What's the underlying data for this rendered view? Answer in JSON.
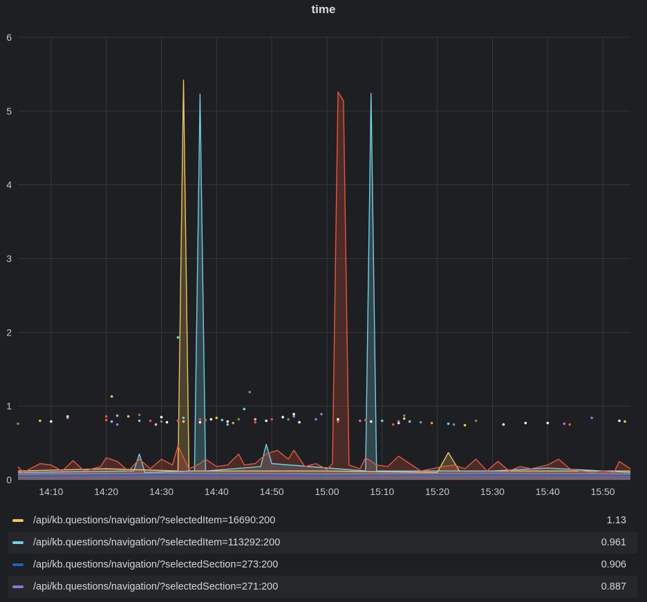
{
  "panel": {
    "title": "time"
  },
  "chart_data": {
    "type": "line",
    "x_ticks": [
      "14:10",
      "14:20",
      "14:30",
      "14:40",
      "14:50",
      "15:00",
      "15:10",
      "15:20",
      "15:30",
      "15:40",
      "15:50"
    ],
    "y_ticks": [
      "0",
      "1",
      "2",
      "3",
      "4",
      "5",
      "6"
    ],
    "ylim": [
      0,
      6
    ],
    "xlim": [
      "14:04",
      "15:55"
    ],
    "grid": true,
    "legend_placement": "bottom",
    "series": [
      {
        "name": "/api/kb.questions/navigation/?selectedItem=16690:200",
        "color": "#f2c55c",
        "legend_value": "1.13",
        "points": [
          [
            "14:04",
            0.12
          ],
          [
            "14:20",
            0.15
          ],
          [
            "14:33",
            0.12
          ],
          [
            "14:34",
            5.42
          ],
          [
            "14:35",
            0.12
          ],
          [
            "14:50",
            0.12
          ],
          [
            "15:00",
            0.12
          ],
          [
            "15:20",
            0.1
          ],
          [
            "15:22",
            0.37
          ],
          [
            "15:24",
            0.12
          ],
          [
            "15:55",
            0.12
          ]
        ]
      },
      {
        "name": "/api/kb.questions/navigation/?selectedItem=113292:200",
        "color": "#73d1e6",
        "legend_value": "0.961",
        "points": [
          [
            "14:04",
            0.1
          ],
          [
            "14:25",
            0.12
          ],
          [
            "14:26",
            0.35
          ],
          [
            "14:27",
            0.1
          ],
          [
            "14:36",
            0.12
          ],
          [
            "14:37",
            5.23
          ],
          [
            "14:38",
            0.12
          ],
          [
            "14:48",
            0.18
          ],
          [
            "14:49",
            0.48
          ],
          [
            "14:50",
            0.22
          ],
          [
            "15:07",
            0.12
          ],
          [
            "15:08",
            5.24
          ],
          [
            "15:09",
            0.12
          ],
          [
            "15:30",
            0.12
          ],
          [
            "15:40",
            0.16
          ],
          [
            "15:55",
            0.1
          ]
        ]
      },
      {
        "name": "/api/kb.questions/navigation/?selectedSection=273:200",
        "color": "#1f60c4",
        "legend_value": "0.906",
        "points": [
          [
            "14:04",
            0.05
          ],
          [
            "14:30",
            0.07
          ],
          [
            "15:00",
            0.06
          ],
          [
            "15:30",
            0.07
          ],
          [
            "15:55",
            0.06
          ]
        ]
      },
      {
        "name": "/api/kb.questions/navigation/?selectedSection=271:200",
        "color": "#8f7bc7",
        "legend_value": "0.887",
        "points": [
          [
            "14:04",
            0.08
          ],
          [
            "14:30",
            0.09
          ],
          [
            "15:00",
            0.08
          ],
          [
            "15:30",
            0.09
          ],
          [
            "15:55",
            0.08
          ]
        ]
      },
      {
        "name": "",
        "color": "#e8573f",
        "legend_value": "",
        "points": [
          [
            "14:04",
            0.18
          ],
          [
            "14:05",
            0.1
          ],
          [
            "14:08",
            0.22
          ],
          [
            "14:10",
            0.2
          ],
          [
            "14:12",
            0.12
          ],
          [
            "14:14",
            0.26
          ],
          [
            "14:16",
            0.12
          ],
          [
            "14:19",
            0.18
          ],
          [
            "14:20",
            0.3
          ],
          [
            "14:22",
            0.25
          ],
          [
            "14:24",
            0.12
          ],
          [
            "14:26",
            0.28
          ],
          [
            "14:28",
            0.15
          ],
          [
            "14:30",
            0.28
          ],
          [
            "14:32",
            0.2
          ],
          [
            "14:33",
            0.46
          ],
          [
            "14:35",
            0.15
          ],
          [
            "14:37",
            0.22
          ],
          [
            "14:38",
            0.28
          ],
          [
            "14:40",
            0.18
          ],
          [
            "14:42",
            0.2
          ],
          [
            "14:44",
            0.35
          ],
          [
            "14:45",
            0.2
          ],
          [
            "14:47",
            0.22
          ],
          [
            "14:49",
            0.35
          ],
          [
            "14:51",
            0.4
          ],
          [
            "14:53",
            0.28
          ],
          [
            "14:54",
            0.4
          ],
          [
            "14:56",
            0.18
          ],
          [
            "14:58",
            0.22
          ],
          [
            "15:00",
            0.14
          ],
          [
            "15:01",
            0.22
          ],
          [
            "15:02",
            5.26
          ],
          [
            "15:03",
            5.14
          ],
          [
            "15:04",
            0.2
          ],
          [
            "15:06",
            0.15
          ],
          [
            "15:07",
            0.3
          ],
          [
            "15:09",
            0.2
          ],
          [
            "15:11",
            0.18
          ],
          [
            "15:13",
            0.32
          ],
          [
            "15:15",
            0.22
          ],
          [
            "15:17",
            0.12
          ],
          [
            "15:19",
            0.15
          ],
          [
            "15:21",
            0.18
          ],
          [
            "15:23",
            0.2
          ],
          [
            "15:25",
            0.15
          ],
          [
            "15:27",
            0.28
          ],
          [
            "15:29",
            0.12
          ],
          [
            "15:31",
            0.25
          ],
          [
            "15:33",
            0.12
          ],
          [
            "15:35",
            0.18
          ],
          [
            "15:37",
            0.15
          ],
          [
            "15:40",
            0.2
          ],
          [
            "15:42",
            0.28
          ],
          [
            "15:44",
            0.15
          ],
          [
            "15:46",
            0.12
          ],
          [
            "15:48",
            0.1
          ],
          [
            "15:50",
            0.12
          ],
          [
            "15:52",
            0.1
          ],
          [
            "15:53",
            0.25
          ],
          [
            "15:55",
            0.15
          ]
        ]
      }
    ],
    "scatter_points": [
      {
        "t": "14:04",
        "v": 0.76,
        "c": "#56a64b"
      },
      {
        "t": "14:08",
        "v": 0.8,
        "c": "#f2c55c"
      },
      {
        "t": "14:10",
        "v": 0.79,
        "c": "#ffffff"
      },
      {
        "t": "14:13",
        "v": 0.84,
        "c": "#b877d9"
      },
      {
        "t": "14:13",
        "v": 0.86,
        "c": "#e0e0e0"
      },
      {
        "t": "14:20",
        "v": 0.86,
        "c": "#e8573f"
      },
      {
        "t": "14:20",
        "v": 0.81,
        "c": "#e8573f"
      },
      {
        "t": "14:21",
        "v": 1.13,
        "c": "#f2c55c"
      },
      {
        "t": "14:21",
        "v": 0.79,
        "c": "#73d1e6"
      },
      {
        "t": "14:22",
        "v": 0.87,
        "c": "#73d1e6"
      },
      {
        "t": "14:22",
        "v": 0.75,
        "c": "#b877d9"
      },
      {
        "t": "14:24",
        "v": 0.86,
        "c": "#f2c55c"
      },
      {
        "t": "14:26",
        "v": 0.88,
        "c": "#a8723f"
      },
      {
        "t": "14:26",
        "v": 0.8,
        "c": "#73d1e6"
      },
      {
        "t": "14:28",
        "v": 0.8,
        "c": "#e8573f"
      },
      {
        "t": "14:29",
        "v": 0.75,
        "c": "#ffb3c7"
      },
      {
        "t": "14:30",
        "v": 0.85,
        "c": "#ffffff"
      },
      {
        "t": "14:30",
        "v": 0.79,
        "c": "#56a64b"
      },
      {
        "t": "14:31",
        "v": 0.78,
        "c": "#ffffff"
      },
      {
        "t": "14:33",
        "v": 1.93,
        "c": "#73d1e6"
      },
      {
        "t": "14:33",
        "v": 0.8,
        "c": "#e8573f"
      },
      {
        "t": "14:34",
        "v": 0.84,
        "c": "#8ab8ff"
      },
      {
        "t": "14:34",
        "v": 0.79,
        "c": "#f2c55c"
      },
      {
        "t": "14:37",
        "v": 0.82,
        "c": "#e8573f"
      },
      {
        "t": "14:37",
        "v": 0.78,
        "c": "#ffffff"
      },
      {
        "t": "14:38",
        "v": 0.81,
        "c": "#e8573f"
      },
      {
        "t": "14:39",
        "v": 0.82,
        "c": "#ffffff"
      },
      {
        "t": "14:40",
        "v": 0.84,
        "c": "#f2c55c"
      },
      {
        "t": "14:41",
        "v": 0.81,
        "c": "#73d1e6"
      },
      {
        "t": "14:42",
        "v": 0.75,
        "c": "#73d1e6"
      },
      {
        "t": "14:42",
        "v": 0.79,
        "c": "#ffffff"
      },
      {
        "t": "14:43",
        "v": 0.77,
        "c": "#ff9830"
      },
      {
        "t": "14:44",
        "v": 0.82,
        "c": "#56a64b"
      },
      {
        "t": "14:45",
        "v": 0.96,
        "c": "#73d1e6"
      },
      {
        "t": "14:46",
        "v": 1.19,
        "c": "#56a64b"
      },
      {
        "t": "14:47",
        "v": 0.78,
        "c": "#e8573f"
      },
      {
        "t": "14:47",
        "v": 0.82,
        "c": "#ffb3c7"
      },
      {
        "t": "14:49",
        "v": 0.8,
        "c": "#ffffff"
      },
      {
        "t": "14:50",
        "v": 0.82,
        "c": "#e8573f"
      },
      {
        "t": "14:52",
        "v": 0.85,
        "c": "#ffffff"
      },
      {
        "t": "14:53",
        "v": 0.82,
        "c": "#56a64b"
      },
      {
        "t": "14:54",
        "v": 0.89,
        "c": "#ffffff"
      },
      {
        "t": "14:54",
        "v": 0.86,
        "c": "#b877d9"
      },
      {
        "t": "14:55",
        "v": 0.78,
        "c": "#ffffff"
      },
      {
        "t": "14:58",
        "v": 0.82,
        "c": "#5794f2"
      },
      {
        "t": "14:59",
        "v": 0.89,
        "c": "#8f7bc7"
      },
      {
        "t": "15:02",
        "v": 0.82,
        "c": "#ffffff"
      },
      {
        "t": "15:02",
        "v": 0.79,
        "c": "#e8573f"
      },
      {
        "t": "15:06",
        "v": 0.8,
        "c": "#b877d9"
      },
      {
        "t": "15:07",
        "v": 0.81,
        "c": "#e8573f"
      },
      {
        "t": "15:08",
        "v": 0.79,
        "c": "#ffffff"
      },
      {
        "t": "15:10",
        "v": 0.8,
        "c": "#73d1e6"
      },
      {
        "t": "15:12",
        "v": 0.75,
        "c": "#e8573f"
      },
      {
        "t": "15:13",
        "v": 0.77,
        "c": "#ffffff"
      },
      {
        "t": "15:13",
        "v": 0.79,
        "c": "#b877d9"
      },
      {
        "t": "15:14",
        "v": 0.87,
        "c": "#56a64b"
      },
      {
        "t": "15:14",
        "v": 0.83,
        "c": "#f2c55c"
      },
      {
        "t": "15:15",
        "v": 0.79,
        "c": "#73d1e6"
      },
      {
        "t": "15:17",
        "v": 0.78,
        "c": "#8f7bc7"
      },
      {
        "t": "15:19",
        "v": 0.77,
        "c": "#ff9830"
      },
      {
        "t": "15:22",
        "v": 0.76,
        "c": "#73d1e6"
      },
      {
        "t": "15:23",
        "v": 0.75,
        "c": "#8f7bc7"
      },
      {
        "t": "15:25",
        "v": 0.74,
        "c": "#f2c55c"
      },
      {
        "t": "15:27",
        "v": 0.8,
        "c": "#a8723f"
      },
      {
        "t": "15:32",
        "v": 0.75,
        "c": "#ffffff"
      },
      {
        "t": "15:36",
        "v": 0.77,
        "c": "#ffffff"
      },
      {
        "t": "15:40",
        "v": 0.77,
        "c": "#ffffff"
      },
      {
        "t": "15:43",
        "v": 0.76,
        "c": "#b877d9"
      },
      {
        "t": "15:44",
        "v": 0.75,
        "c": "#e8573f"
      },
      {
        "t": "15:48",
        "v": 0.84,
        "c": "#5794f2"
      },
      {
        "t": "15:53",
        "v": 0.8,
        "c": "#ffffff"
      },
      {
        "t": "15:54",
        "v": 0.79,
        "c": "#f2c55c"
      }
    ]
  },
  "legend_items": [
    {
      "name": "/api/kb.questions/navigation/?selectedItem=16690:200",
      "value": "1.13",
      "color": "#f2c55c"
    },
    {
      "name": "/api/kb.questions/navigation/?selectedItem=113292:200",
      "value": "0.961",
      "color": "#73d1e6"
    },
    {
      "name": "/api/kb.questions/navigation/?selectedSection=273:200",
      "value": "0.906",
      "color": "#1f60c4"
    },
    {
      "name": "/api/kb.questions/navigation/?selectedSection=271:200",
      "value": "0.887",
      "color": "#8f7bc7"
    }
  ]
}
